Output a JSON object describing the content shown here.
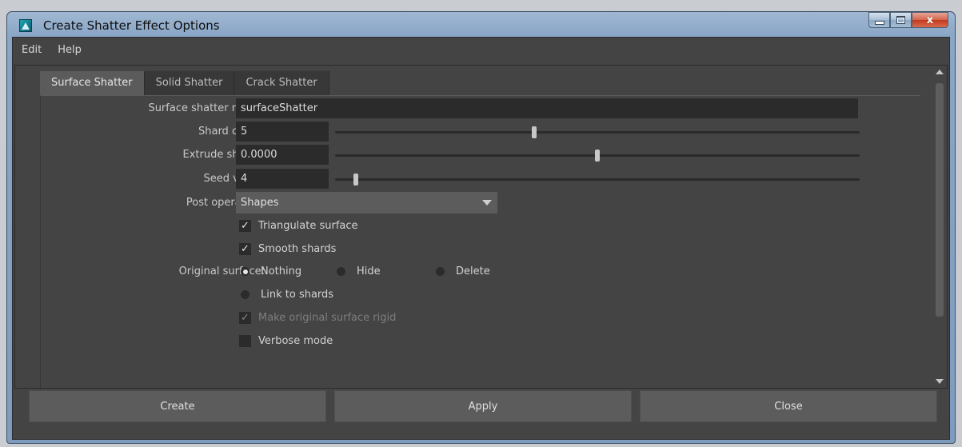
{
  "window": {
    "title": "Create Shatter Effect Options"
  },
  "menu": {
    "items": [
      "Edit",
      "Help"
    ]
  },
  "tabs": [
    {
      "label": "Surface Shatter",
      "active": true
    },
    {
      "label": "Solid Shatter",
      "active": false
    },
    {
      "label": "Crack Shatter",
      "active": false
    }
  ],
  "form": {
    "name": {
      "label": "Surface shatter name:",
      "value": "surfaceShatter"
    },
    "shard_count": {
      "label": "Shard count:",
      "value": "5",
      "slider_fraction": 0.38
    },
    "extrude_shards": {
      "label": "Extrude shards:",
      "value": "0.0000",
      "slider_fraction": 0.5
    },
    "seed_value": {
      "label": "Seed value:",
      "value": "4",
      "slider_fraction": 0.04
    },
    "post_operation": {
      "label": "Post operation:",
      "value": "Shapes"
    },
    "triangulate": {
      "label": "Triangulate surface",
      "checked": true
    },
    "smooth": {
      "label": "Smooth shards",
      "checked": true
    },
    "original_surface": {
      "label": "Original surface:",
      "options": [
        {
          "label": "Nothing",
          "selected": true
        },
        {
          "label": "Hide",
          "selected": false
        },
        {
          "label": "Delete",
          "selected": false
        },
        {
          "label": "Link to shards",
          "selected": false
        }
      ]
    },
    "rigid": {
      "label": "Make original surface rigid",
      "checked": true,
      "enabled": false
    },
    "verbose": {
      "label": "Verbose mode",
      "checked": false
    }
  },
  "buttons": {
    "create": "Create",
    "apply": "Apply",
    "close": "Close"
  },
  "glyphs": {
    "check": "✓",
    "close_x": "x"
  },
  "colors": {
    "panel": "#444444",
    "field": "#2b2b2b",
    "active_tab": "#5b5b5b",
    "button": "#5c5c5c"
  }
}
